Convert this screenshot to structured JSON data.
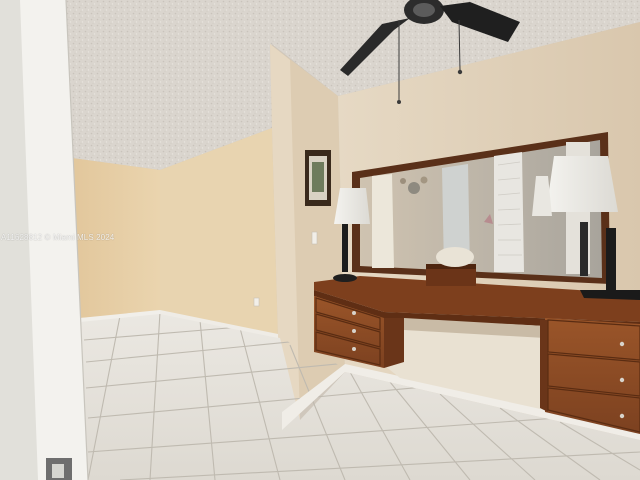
{
  "watermark": {
    "text": "A11628812 © Miami MLS 2024"
  },
  "palette": {
    "ceiling": "#dcd8d2",
    "wall_warm": "#e4cfa8",
    "wall_light": "#e8dcc8",
    "floor_tile": "#e6e3dc",
    "grout": "#bdb8ae",
    "wood": "#8f4d25",
    "wood_dark": "#6e3818",
    "door_frame": "#ecebe6"
  }
}
